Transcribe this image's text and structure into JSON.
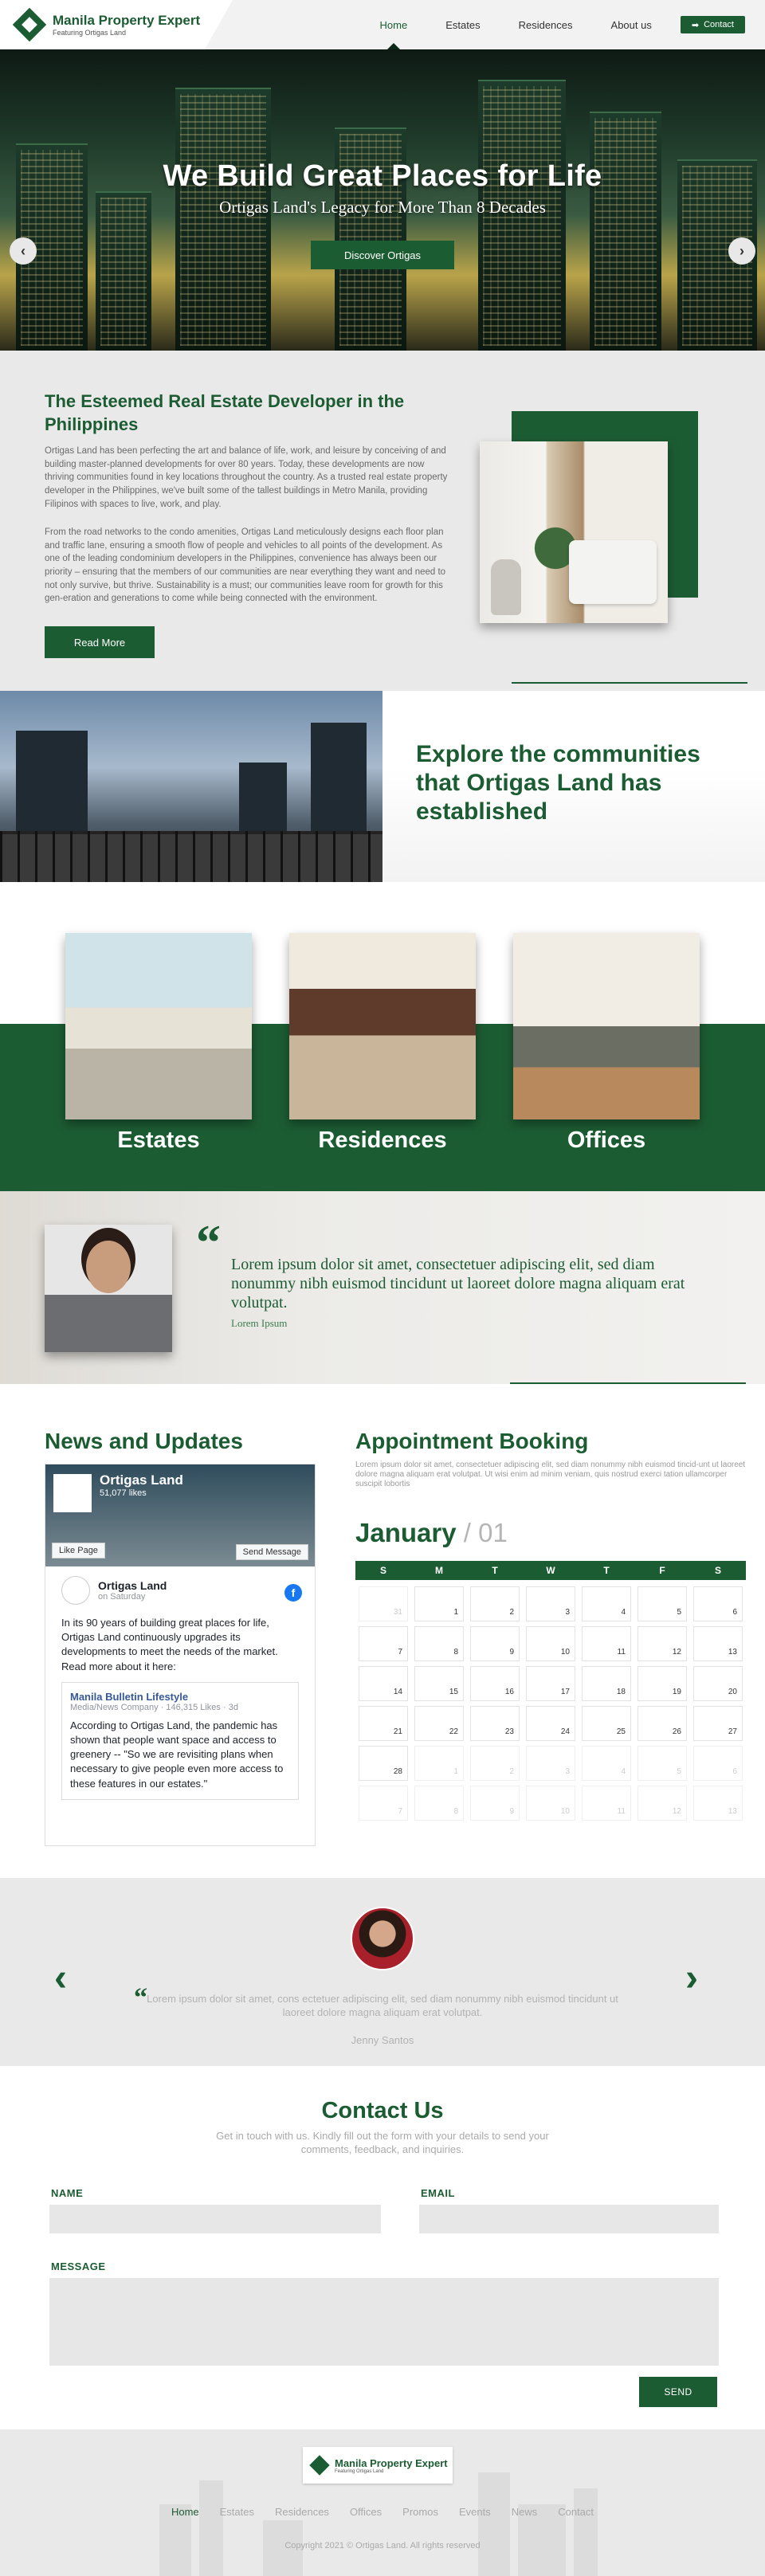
{
  "header": {
    "logo_title": "Manila Property Expert",
    "logo_subtitle": "Featuring Ortigas Land",
    "nav": [
      "Home",
      "Estates",
      "Residences",
      "About us"
    ],
    "contact_label": "Contact",
    "active_nav": "Home"
  },
  "hero": {
    "title": "We Build Great Places for Life",
    "subtitle": "Ortigas Land's Legacy for More Than 8 Decades",
    "button": "Discover Ortigas"
  },
  "about": {
    "title": "The Esteemed Real Estate Developer in the Philippines",
    "para1": "Ortigas Land has been perfecting the art and balance of life, work, and leisure by conceiving of and building master-planned developments for over 80 years. Today, these developments are now thriving communities found in key locations throughout the country. As a trusted real estate property developer in the Philippines, we've built some of the tallest buildings in Metro Manila, providing Filipinos with spaces to live, work, and play.",
    "para2": "From the road networks to the condo amenities, Ortigas Land meticulously designs each floor plan and traffic lane, ensuring a smooth flow of people and vehicles to all points of the development. As one of the leading condominium developers in the Philippines, convenience has always been our priority – ensuring that the members of our communities are near everything they want and need to not only survive, but thrive. Sustainability is a must; our communities leave room for growth for this gen-eration and generations to come while being connected with the environment.",
    "button": "Read More"
  },
  "explore": {
    "title": "Explore the communities that Ortigas Land has established"
  },
  "categories": [
    "Estates",
    "Residences",
    "Offices"
  ],
  "testimonial": {
    "quote": "Lorem ipsum dolor sit amet, consectetuer adipiscing elit, sed diam nonummy nibh euismod tincidunt ut laoreet dolore magna aliquam erat volutpat.",
    "author": "Lorem Ipsum"
  },
  "news": {
    "title": "News and Updates",
    "fb_page_name": "Ortigas Land",
    "fb_likes": "51,077 likes",
    "fb_like_page": "Like Page",
    "fb_send_message": "Send Message",
    "post_author": "Ortigas Land",
    "post_time": "on Saturday",
    "post_text": "In its 90 years of building great places for life, Ortigas Land continuously upgrades its developments to meet the needs of the market. Read more about it here:",
    "embed_source": "Manila Bulletin Lifestyle",
    "embed_meta": "Media/News Company · 146,315 Likes · 3d",
    "embed_text": "According to Ortigas Land, the pandemic has shown that people want space and access to greenery -- \"So we are revisiting plans when necessary to give people even more access to these features in our estates.\""
  },
  "appointment": {
    "title": "Appointment Booking",
    "description": "Lorem ipsum dolor sit amet, consectetuer adipiscing elit, sed diam nonummy nibh euismod tincid-unt ut laoreet dolore magna aliquam erat volutpat. Ut wisi enim ad minim veniam, quis nostrud exerci tation ullamcorper suscipit lobortis",
    "month": "January",
    "month_num": "/ 01",
    "weekdays": [
      "S",
      "M",
      "T",
      "W",
      "T",
      "F",
      "S"
    ],
    "days": [
      {
        "n": "31",
        "m": true
      },
      {
        "n": "1"
      },
      {
        "n": "2"
      },
      {
        "n": "3"
      },
      {
        "n": "4"
      },
      {
        "n": "5"
      },
      {
        "n": "6"
      },
      {
        "n": "7"
      },
      {
        "n": "8"
      },
      {
        "n": "9"
      },
      {
        "n": "10"
      },
      {
        "n": "11"
      },
      {
        "n": "12"
      },
      {
        "n": "13"
      },
      {
        "n": "14"
      },
      {
        "n": "15"
      },
      {
        "n": "16"
      },
      {
        "n": "17"
      },
      {
        "n": "18"
      },
      {
        "n": "19"
      },
      {
        "n": "20"
      },
      {
        "n": "21"
      },
      {
        "n": "22"
      },
      {
        "n": "23"
      },
      {
        "n": "24"
      },
      {
        "n": "25"
      },
      {
        "n": "26"
      },
      {
        "n": "27"
      },
      {
        "n": "28"
      },
      {
        "n": "1",
        "m": true
      },
      {
        "n": "2",
        "m": true
      },
      {
        "n": "3",
        "m": true
      },
      {
        "n": "4",
        "m": true
      },
      {
        "n": "5",
        "m": true
      },
      {
        "n": "6",
        "m": true
      },
      {
        "n": "7",
        "m": true
      },
      {
        "n": "8",
        "m": true
      },
      {
        "n": "9",
        "m": true
      },
      {
        "n": "10",
        "m": true
      },
      {
        "n": "11",
        "m": true
      },
      {
        "n": "12",
        "m": true
      },
      {
        "n": "13",
        "m": true
      }
    ]
  },
  "review": {
    "text": "Lorem ipsum dolor sit amet, cons ectetuer adipiscing elit, sed diam nonummy nibh euismod tincidunt ut laoreet dolore magna aliquam erat volutpat.",
    "name": "Jenny Santos"
  },
  "contact": {
    "title": "Contact Us",
    "description": "Get in touch with us. Kindly fill out the form with your details to send your comments, feedback, and inquiries.",
    "name_label": "NAME",
    "email_label": "EMAIL",
    "message_label": "MESSAGE",
    "send_label": "SEND"
  },
  "footer": {
    "logo_title": "Manila Property Expert",
    "nav": [
      "Home",
      "Estates",
      "Residences",
      "Offices",
      "Promos",
      "Events",
      "News",
      "Contact"
    ],
    "active_nav": "Home",
    "copyright": "Copyright 2021 © Ortigas Land.  All rights reserved"
  },
  "colors": {
    "brand_green": "#1c5c33",
    "light_gray": "#e9e9e9"
  }
}
